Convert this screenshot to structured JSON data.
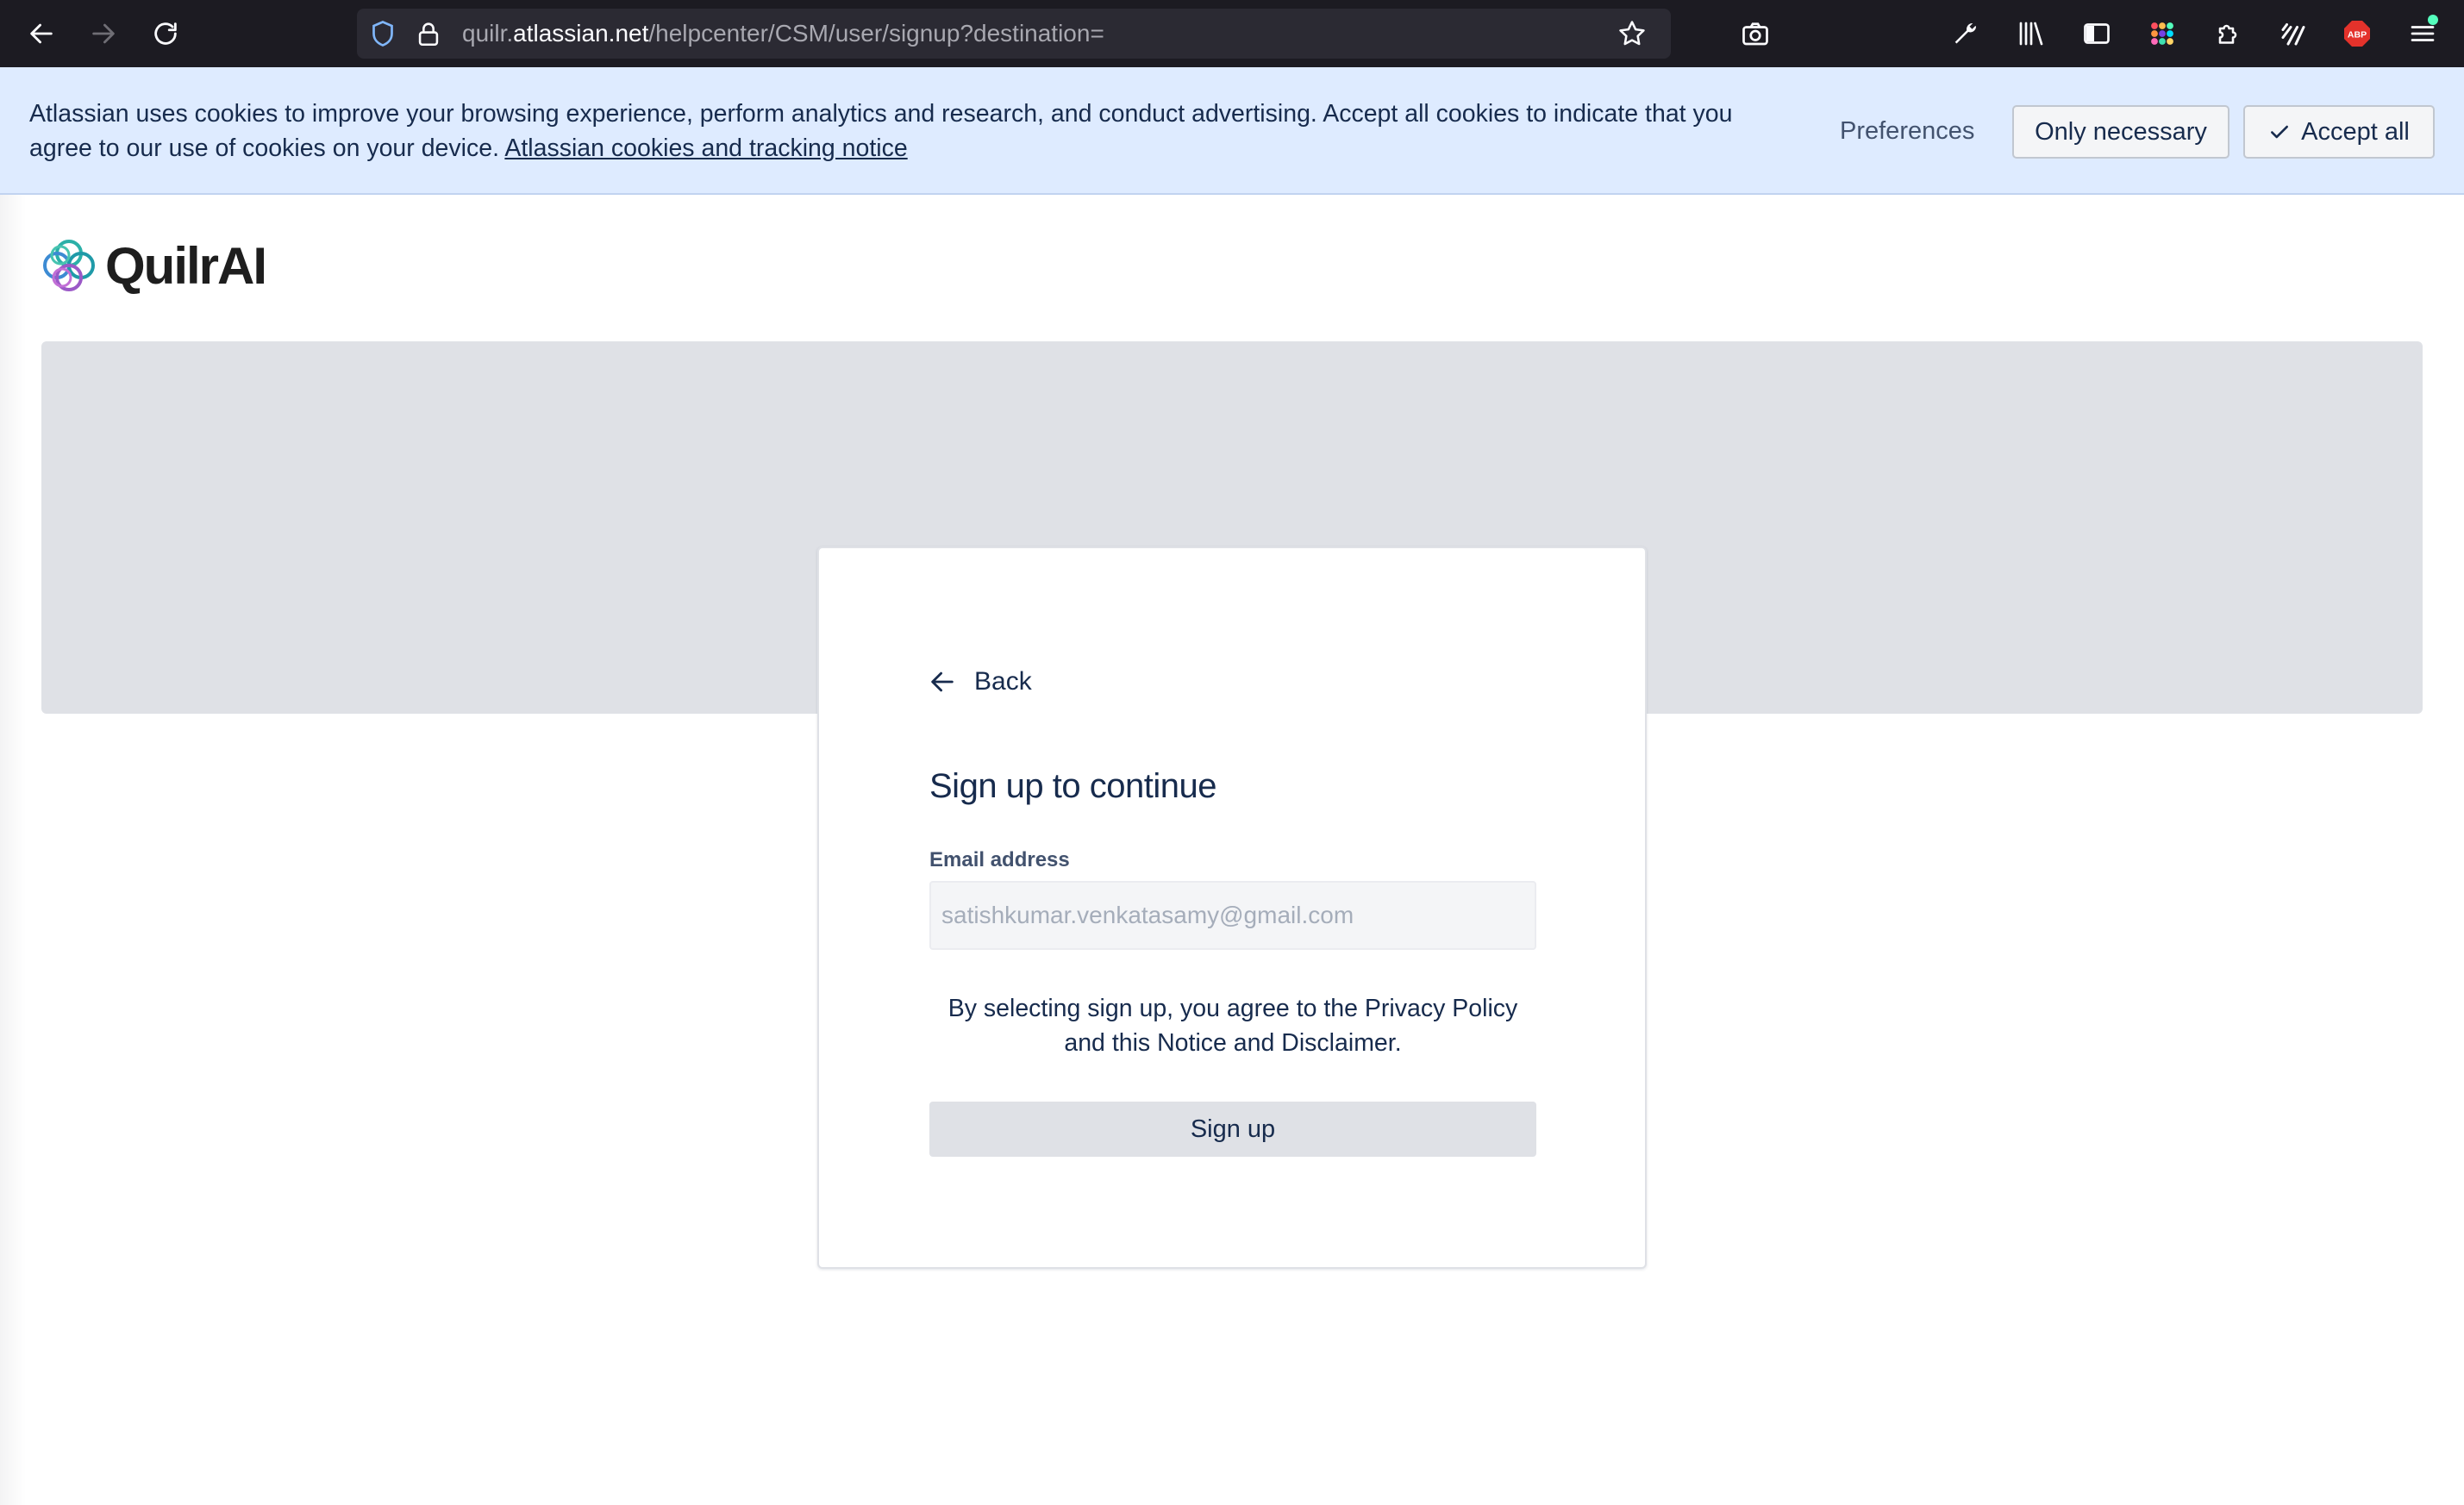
{
  "browser": {
    "url_prefix": "quilr.",
    "url_domain": "atlassian.net",
    "url_path": "/helpcenter/CSM/user/signup?destination=",
    "extension_badge": "ABP"
  },
  "cookie_banner": {
    "text": "Atlassian uses cookies to improve your browsing experience, perform analytics and research, and conduct advertising. Accept all cookies to indicate that you agree to our use of cookies on your device.",
    "link": "Atlassian cookies and tracking notice",
    "preferences": "Preferences",
    "only_necessary": "Only necessary",
    "accept_all": "Accept all"
  },
  "logo": {
    "text": "QuilrAI"
  },
  "signup_card": {
    "back": "Back",
    "heading": "Sign up to continue",
    "email_label": "Email address",
    "email_placeholder": "satishkumar.venkatasamy@gmail.com",
    "terms": "By selecting sign up, you agree to the Privacy Policy and this Notice and Disclaimer.",
    "submit": "Sign up"
  },
  "colors": {
    "chrome_bg": "#1c1b22",
    "urlbar_bg": "#2b2a33",
    "cookie_bg": "#deebff",
    "banner_bg": "#dfe1e6",
    "text_primary": "#172b4d"
  }
}
